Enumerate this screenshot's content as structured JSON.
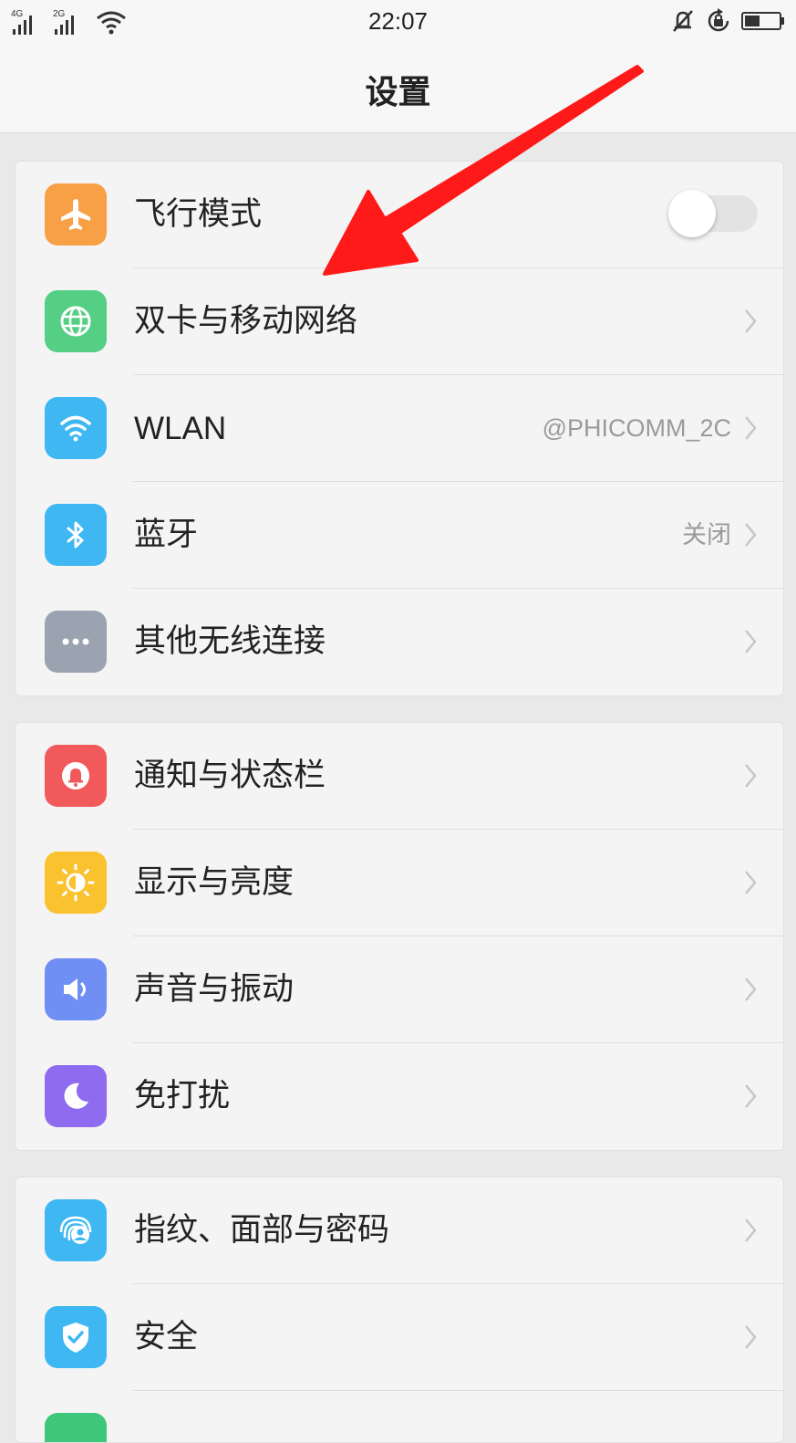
{
  "status_bar": {
    "sim1_tag": "4G",
    "sim2_tag": "2G",
    "time": "22:07"
  },
  "header": {
    "title": "设置"
  },
  "groups": [
    {
      "items": [
        {
          "label": "飞行模式",
          "icon": "airplane-icon",
          "color": "#f7a045",
          "toggle": false
        },
        {
          "label": "双卡与移动网络",
          "icon": "globe-icon",
          "color": "#55cf83"
        },
        {
          "label": "WLAN",
          "icon": "wifi-icon",
          "color": "#3fb7f3",
          "value": "@PHICOMM_2C"
        },
        {
          "label": "蓝牙",
          "icon": "bluetooth-icon",
          "color": "#3fb7f3",
          "value": "关闭"
        },
        {
          "label": "其他无线连接",
          "icon": "more-icon",
          "color": "#9aa3af"
        }
      ]
    },
    {
      "items": [
        {
          "label": "通知与状态栏",
          "icon": "bell-icon",
          "color": "#f2595a"
        },
        {
          "label": "显示与亮度",
          "icon": "brightness-icon",
          "color": "#f9c22e"
        },
        {
          "label": "声音与振动",
          "icon": "speaker-icon",
          "color": "#6f8ff5"
        },
        {
          "label": "免打扰",
          "icon": "moon-icon",
          "color": "#8f6bf0"
        }
      ]
    },
    {
      "items": [
        {
          "label": "指纹、面部与密码",
          "icon": "fingerprint-icon",
          "color": "#3fb7f3"
        },
        {
          "label": "安全",
          "icon": "shield-icon",
          "color": "#3fb7f3"
        },
        {
          "label": "",
          "icon": "partial-icon",
          "color": "#3ec77a"
        }
      ]
    }
  ],
  "annotation": {
    "color": "#ff1a1a"
  }
}
